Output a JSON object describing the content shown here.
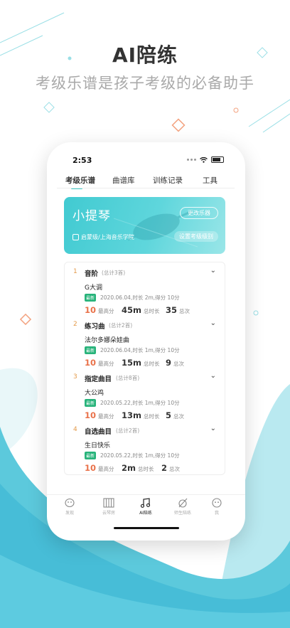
{
  "header": {
    "title": "AI陪练",
    "subtitle": "考级乐谱是孩子考级的必备助手"
  },
  "status_bar": {
    "time": "2:53"
  },
  "tabs": [
    "考级乐谱",
    "曲谱库",
    "训练记录",
    "工具"
  ],
  "banner": {
    "instrument": "小提琴",
    "change_label": "更改乐器",
    "level_info": "启蒙级/上海音乐学院",
    "set_level_label": "设置考级级别"
  },
  "sections": [
    {
      "num": "1",
      "title": "音阶",
      "count": "(总计3首)",
      "song": "G大调",
      "badge": "最新",
      "meta": "2020.06.04,时长 2m,得分 10分",
      "score": "10",
      "score_label": "最高分",
      "duration": "45m",
      "duration_label": "总时长",
      "times": "35",
      "times_label": "总次"
    },
    {
      "num": "2",
      "title": "练习曲",
      "count": "(总计2首)",
      "song": "法尔多娜朵娃曲",
      "badge": "最新",
      "meta": "2020.06.04,时长 1m,得分 10分",
      "score": "10",
      "score_label": "最高分",
      "duration": "15m",
      "duration_label": "总时长",
      "times": "9",
      "times_label": "总次"
    },
    {
      "num": "3",
      "title": "指定曲目",
      "count": "(总计8首)",
      "song": "大公鸡",
      "badge": "最新",
      "meta": "2020.05.22,时长 1m,得分 10分",
      "score": "10",
      "score_label": "最高分",
      "duration": "13m",
      "duration_label": "总时长",
      "times": "5",
      "times_label": "总次"
    },
    {
      "num": "4",
      "title": "自选曲目",
      "count": "(总计2首)",
      "song": "生日快乐",
      "badge": "最新",
      "meta": "2020.05.22,时长 1m,得分 10分",
      "score": "10",
      "score_label": "最高分",
      "duration": "2m",
      "duration_label": "总时长",
      "times": "2",
      "times_label": "总次"
    }
  ],
  "bottom_nav": [
    {
      "label": "发现",
      "icon": "discover-icon"
    },
    {
      "label": "云琴房",
      "icon": "piano-icon"
    },
    {
      "label": "AI陪练",
      "icon": "music-note-icon"
    },
    {
      "label": "师生陪练",
      "icon": "teacher-icon"
    },
    {
      "label": "我",
      "icon": "profile-icon"
    }
  ],
  "colors": {
    "accent": "#3ecbc7",
    "score": "#e9724a",
    "badge": "#27b37a"
  }
}
